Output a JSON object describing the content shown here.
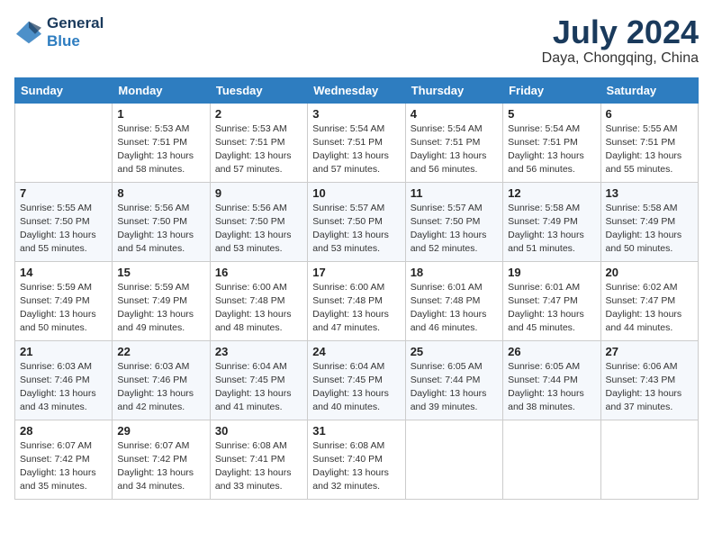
{
  "header": {
    "logo_line1": "General",
    "logo_line2": "Blue",
    "month_year": "July 2024",
    "location": "Daya, Chongqing, China"
  },
  "weekdays": [
    "Sunday",
    "Monday",
    "Tuesday",
    "Wednesday",
    "Thursday",
    "Friday",
    "Saturday"
  ],
  "weeks": [
    [
      {
        "day": "",
        "sunrise": "",
        "sunset": "",
        "daylight": ""
      },
      {
        "day": "1",
        "sunrise": "Sunrise: 5:53 AM",
        "sunset": "Sunset: 7:51 PM",
        "daylight": "Daylight: 13 hours and 58 minutes."
      },
      {
        "day": "2",
        "sunrise": "Sunrise: 5:53 AM",
        "sunset": "Sunset: 7:51 PM",
        "daylight": "Daylight: 13 hours and 57 minutes."
      },
      {
        "day": "3",
        "sunrise": "Sunrise: 5:54 AM",
        "sunset": "Sunset: 7:51 PM",
        "daylight": "Daylight: 13 hours and 57 minutes."
      },
      {
        "day": "4",
        "sunrise": "Sunrise: 5:54 AM",
        "sunset": "Sunset: 7:51 PM",
        "daylight": "Daylight: 13 hours and 56 minutes."
      },
      {
        "day": "5",
        "sunrise": "Sunrise: 5:54 AM",
        "sunset": "Sunset: 7:51 PM",
        "daylight": "Daylight: 13 hours and 56 minutes."
      },
      {
        "day": "6",
        "sunrise": "Sunrise: 5:55 AM",
        "sunset": "Sunset: 7:51 PM",
        "daylight": "Daylight: 13 hours and 55 minutes."
      }
    ],
    [
      {
        "day": "7",
        "sunrise": "Sunrise: 5:55 AM",
        "sunset": "Sunset: 7:50 PM",
        "daylight": "Daylight: 13 hours and 55 minutes."
      },
      {
        "day": "8",
        "sunrise": "Sunrise: 5:56 AM",
        "sunset": "Sunset: 7:50 PM",
        "daylight": "Daylight: 13 hours and 54 minutes."
      },
      {
        "day": "9",
        "sunrise": "Sunrise: 5:56 AM",
        "sunset": "Sunset: 7:50 PM",
        "daylight": "Daylight: 13 hours and 53 minutes."
      },
      {
        "day": "10",
        "sunrise": "Sunrise: 5:57 AM",
        "sunset": "Sunset: 7:50 PM",
        "daylight": "Daylight: 13 hours and 53 minutes."
      },
      {
        "day": "11",
        "sunrise": "Sunrise: 5:57 AM",
        "sunset": "Sunset: 7:50 PM",
        "daylight": "Daylight: 13 hours and 52 minutes."
      },
      {
        "day": "12",
        "sunrise": "Sunrise: 5:58 AM",
        "sunset": "Sunset: 7:49 PM",
        "daylight": "Daylight: 13 hours and 51 minutes."
      },
      {
        "day": "13",
        "sunrise": "Sunrise: 5:58 AM",
        "sunset": "Sunset: 7:49 PM",
        "daylight": "Daylight: 13 hours and 50 minutes."
      }
    ],
    [
      {
        "day": "14",
        "sunrise": "Sunrise: 5:59 AM",
        "sunset": "Sunset: 7:49 PM",
        "daylight": "Daylight: 13 hours and 50 minutes."
      },
      {
        "day": "15",
        "sunrise": "Sunrise: 5:59 AM",
        "sunset": "Sunset: 7:49 PM",
        "daylight": "Daylight: 13 hours and 49 minutes."
      },
      {
        "day": "16",
        "sunrise": "Sunrise: 6:00 AM",
        "sunset": "Sunset: 7:48 PM",
        "daylight": "Daylight: 13 hours and 48 minutes."
      },
      {
        "day": "17",
        "sunrise": "Sunrise: 6:00 AM",
        "sunset": "Sunset: 7:48 PM",
        "daylight": "Daylight: 13 hours and 47 minutes."
      },
      {
        "day": "18",
        "sunrise": "Sunrise: 6:01 AM",
        "sunset": "Sunset: 7:48 PM",
        "daylight": "Daylight: 13 hours and 46 minutes."
      },
      {
        "day": "19",
        "sunrise": "Sunrise: 6:01 AM",
        "sunset": "Sunset: 7:47 PM",
        "daylight": "Daylight: 13 hours and 45 minutes."
      },
      {
        "day": "20",
        "sunrise": "Sunrise: 6:02 AM",
        "sunset": "Sunset: 7:47 PM",
        "daylight": "Daylight: 13 hours and 44 minutes."
      }
    ],
    [
      {
        "day": "21",
        "sunrise": "Sunrise: 6:03 AM",
        "sunset": "Sunset: 7:46 PM",
        "daylight": "Daylight: 13 hours and 43 minutes."
      },
      {
        "day": "22",
        "sunrise": "Sunrise: 6:03 AM",
        "sunset": "Sunset: 7:46 PM",
        "daylight": "Daylight: 13 hours and 42 minutes."
      },
      {
        "day": "23",
        "sunrise": "Sunrise: 6:04 AM",
        "sunset": "Sunset: 7:45 PM",
        "daylight": "Daylight: 13 hours and 41 minutes."
      },
      {
        "day": "24",
        "sunrise": "Sunrise: 6:04 AM",
        "sunset": "Sunset: 7:45 PM",
        "daylight": "Daylight: 13 hours and 40 minutes."
      },
      {
        "day": "25",
        "sunrise": "Sunrise: 6:05 AM",
        "sunset": "Sunset: 7:44 PM",
        "daylight": "Daylight: 13 hours and 39 minutes."
      },
      {
        "day": "26",
        "sunrise": "Sunrise: 6:05 AM",
        "sunset": "Sunset: 7:44 PM",
        "daylight": "Daylight: 13 hours and 38 minutes."
      },
      {
        "day": "27",
        "sunrise": "Sunrise: 6:06 AM",
        "sunset": "Sunset: 7:43 PM",
        "daylight": "Daylight: 13 hours and 37 minutes."
      }
    ],
    [
      {
        "day": "28",
        "sunrise": "Sunrise: 6:07 AM",
        "sunset": "Sunset: 7:42 PM",
        "daylight": "Daylight: 13 hours and 35 minutes."
      },
      {
        "day": "29",
        "sunrise": "Sunrise: 6:07 AM",
        "sunset": "Sunset: 7:42 PM",
        "daylight": "Daylight: 13 hours and 34 minutes."
      },
      {
        "day": "30",
        "sunrise": "Sunrise: 6:08 AM",
        "sunset": "Sunset: 7:41 PM",
        "daylight": "Daylight: 13 hours and 33 minutes."
      },
      {
        "day": "31",
        "sunrise": "Sunrise: 6:08 AM",
        "sunset": "Sunset: 7:40 PM",
        "daylight": "Daylight: 13 hours and 32 minutes."
      },
      {
        "day": "",
        "sunrise": "",
        "sunset": "",
        "daylight": ""
      },
      {
        "day": "",
        "sunrise": "",
        "sunset": "",
        "daylight": ""
      },
      {
        "day": "",
        "sunrise": "",
        "sunset": "",
        "daylight": ""
      }
    ]
  ]
}
